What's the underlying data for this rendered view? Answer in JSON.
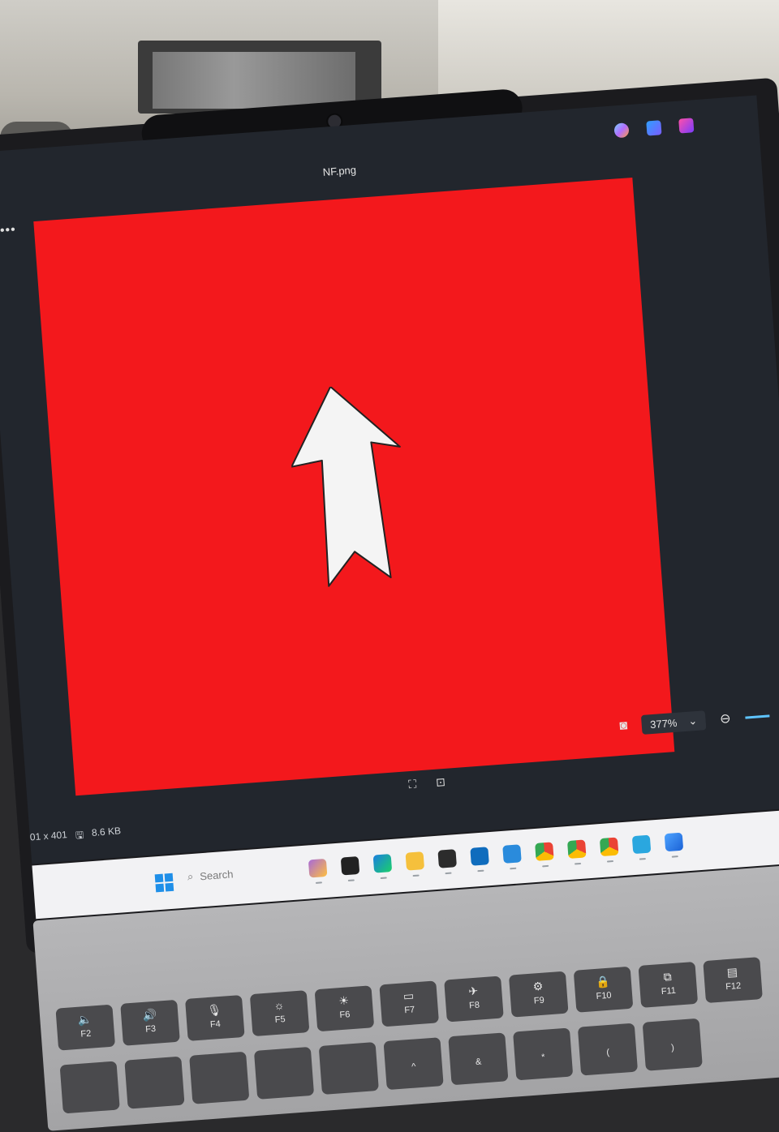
{
  "window": {
    "file_name": "NF.png",
    "more_label": "•••"
  },
  "image": {
    "background_color": "#f3181c",
    "arrow_color": "#f4f4f4",
    "subject": "white up arrow"
  },
  "toolbar": {
    "zoom_value": "377%",
    "zoom_dropdown": "⌄"
  },
  "status": {
    "dimensions": "01 x 401",
    "file_size": "8.6 KB"
  },
  "taskbar": {
    "search_placeholder": "Search"
  },
  "keyboard": {
    "function_keys": [
      "F2",
      "F3",
      "F4",
      "F5",
      "F6",
      "F7",
      "F8",
      "F9",
      "F10",
      "F11",
      "F12"
    ],
    "row2_keys": [
      "",
      "",
      "",
      "",
      "",
      "^",
      "&",
      "*",
      "(",
      ")",
      ""
    ]
  }
}
